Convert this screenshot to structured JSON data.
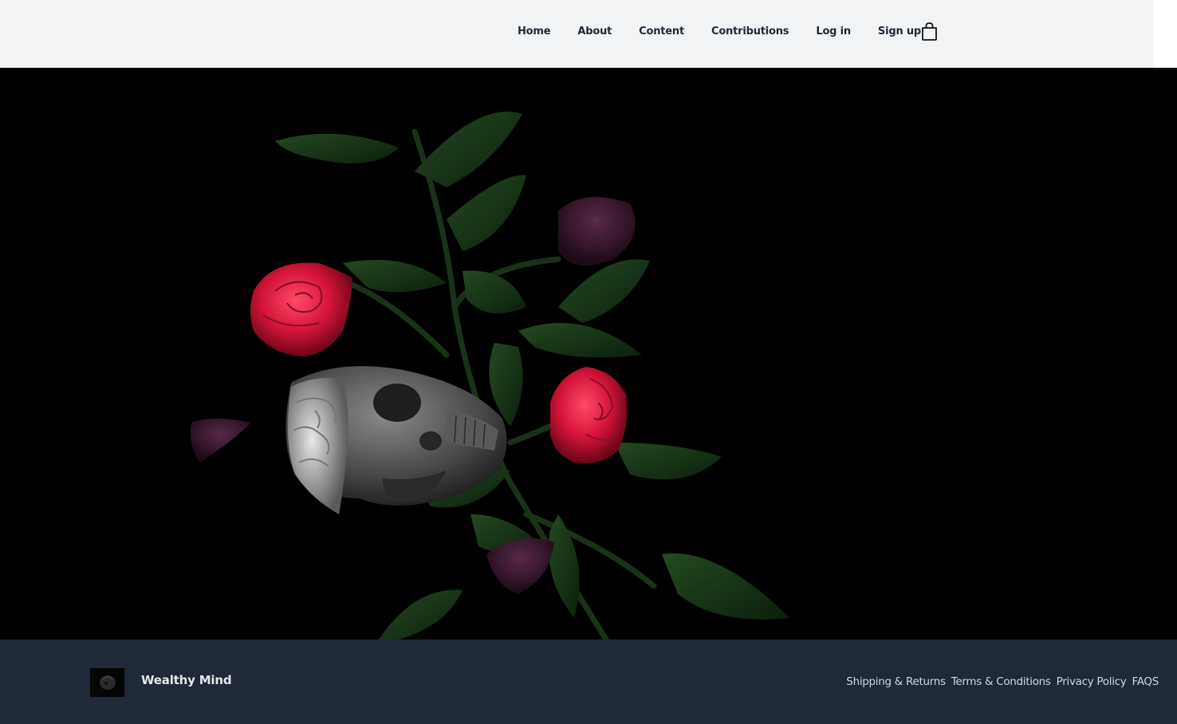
{
  "header": {
    "nav": [
      "Home",
      "About",
      "Content",
      "Contributions",
      "Log in",
      "Sign up"
    ],
    "cart_icon": "shopping-bag-icon"
  },
  "hero": {
    "image": "dark still life: grey skull with exposed brain among red roses, purple buds and green leaves on black background"
  },
  "footer": {
    "brand": "Wealthy Mind",
    "links": [
      "Shipping & Returns",
      "Terms & Conditions",
      "Privacy Policy",
      "FAQS"
    ]
  },
  "colors": {
    "header_bg": "#f2f3f5",
    "footer_bg": "#1f2937",
    "hero_bg": "#000000",
    "rose": "#d4143a"
  }
}
